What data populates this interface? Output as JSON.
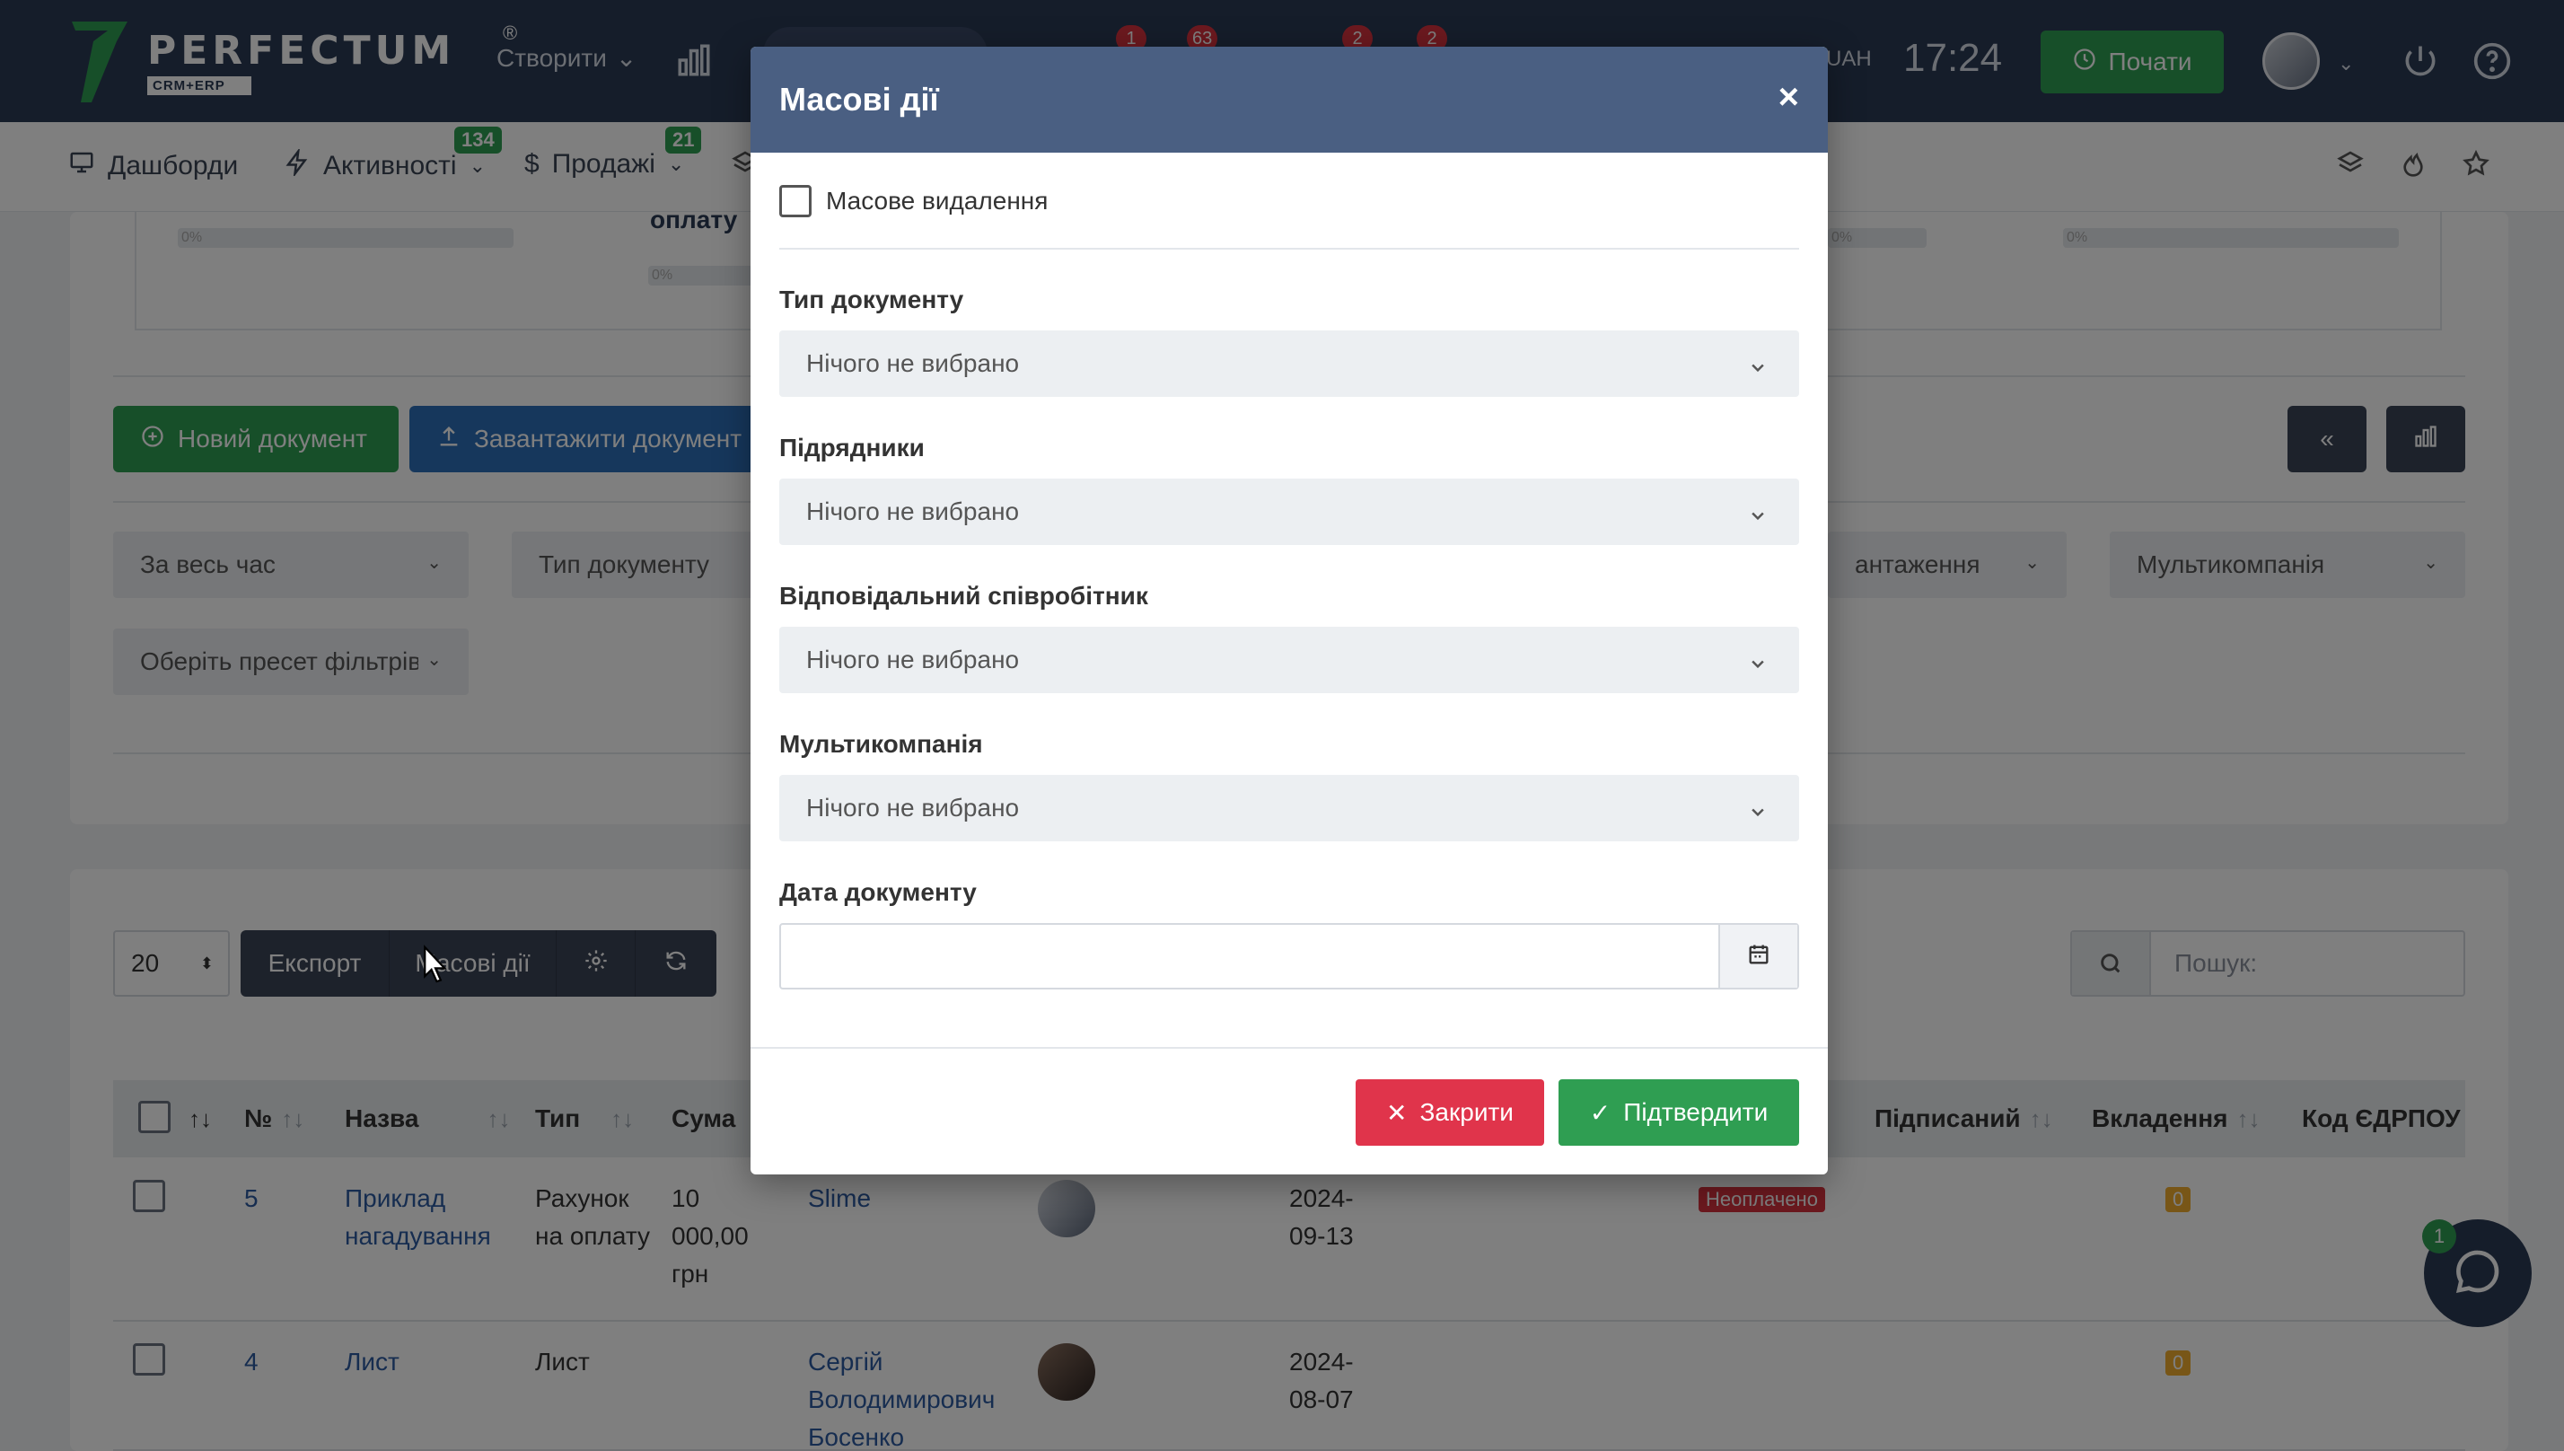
{
  "topbar": {
    "logo_word": "PERFECTUM",
    "logo_reg": "®",
    "logo_sub": "CRM+ERP",
    "create_label": "Створити",
    "notifications": [
      "1",
      "63",
      "2",
      "2"
    ],
    "currency": "UAH",
    "time": "17:24",
    "start_label": "Почати"
  },
  "subnav": {
    "items": [
      {
        "label": "Дашборди",
        "icon": "monitor-icon"
      },
      {
        "label": "Активності",
        "icon": "bolt-icon",
        "badge": "134"
      },
      {
        "label": "Продажі",
        "icon": "dollar-icon",
        "badge": "21"
      }
    ]
  },
  "background": {
    "partial_text": "оплату",
    "progress": [
      "0%",
      "0%",
      "0%",
      "0%"
    ],
    "new_doc_label": "Новий документ",
    "upload_doc_label": "Завантажити документ",
    "filters": {
      "period": "За весь час",
      "doc_type": "Тип документу",
      "upload_partial": "антаження",
      "multicompany": "Мультикомпанія",
      "preset": "Оберіть пресет фільтрів"
    },
    "page_size": "20",
    "toolbar": {
      "export": "Експорт",
      "mass_actions": "Масові дії"
    },
    "search_placeholder": "Пошук:",
    "table": {
      "headers": {
        "num": "№",
        "name": "Назва",
        "type": "Тип",
        "sum": "Сума",
        "signed": "Підписаний",
        "attachments": "Вкладення",
        "edrpou": "Код ЄДРПОУ"
      },
      "rows": [
        {
          "num": "5",
          "name": "Приклад нагадування",
          "type": "Рахунок на оплату",
          "sum": "10 000,00 грн",
          "contractor": "Slime",
          "date": "2024-09-13",
          "status": "Неоплачено",
          "attachments": "0"
        },
        {
          "num": "4",
          "name": "Лист",
          "type": "Лист",
          "sum": "",
          "contractor": "Сергій Володимирович Босенко",
          "date": "2024-08-07",
          "status": "",
          "attachments": "0"
        }
      ]
    },
    "chat_badge": "1"
  },
  "modal": {
    "title": "Масові дії",
    "close_symbol": "×",
    "mass_delete_label": "Масове видалення",
    "fields": [
      {
        "label": "Тип документу",
        "value": "Нічого не вибрано"
      },
      {
        "label": "Підрядники",
        "value": "Нічого не вибрано"
      },
      {
        "label": "Відповідальний співробітник",
        "value": "Нічого не вибрано"
      },
      {
        "label": "Мультикомпанія",
        "value": "Нічого не вибрано"
      }
    ],
    "date_label": "Дата документу",
    "date_value": "",
    "close_button": "Закрити",
    "confirm_button": "Підтвердити"
  },
  "colors": {
    "navbar": "#2b3a55",
    "modal_header": "#4a5f82",
    "primary_green": "#2f9e52",
    "danger_red": "#e0344b",
    "link_blue": "#2d5aa0"
  }
}
